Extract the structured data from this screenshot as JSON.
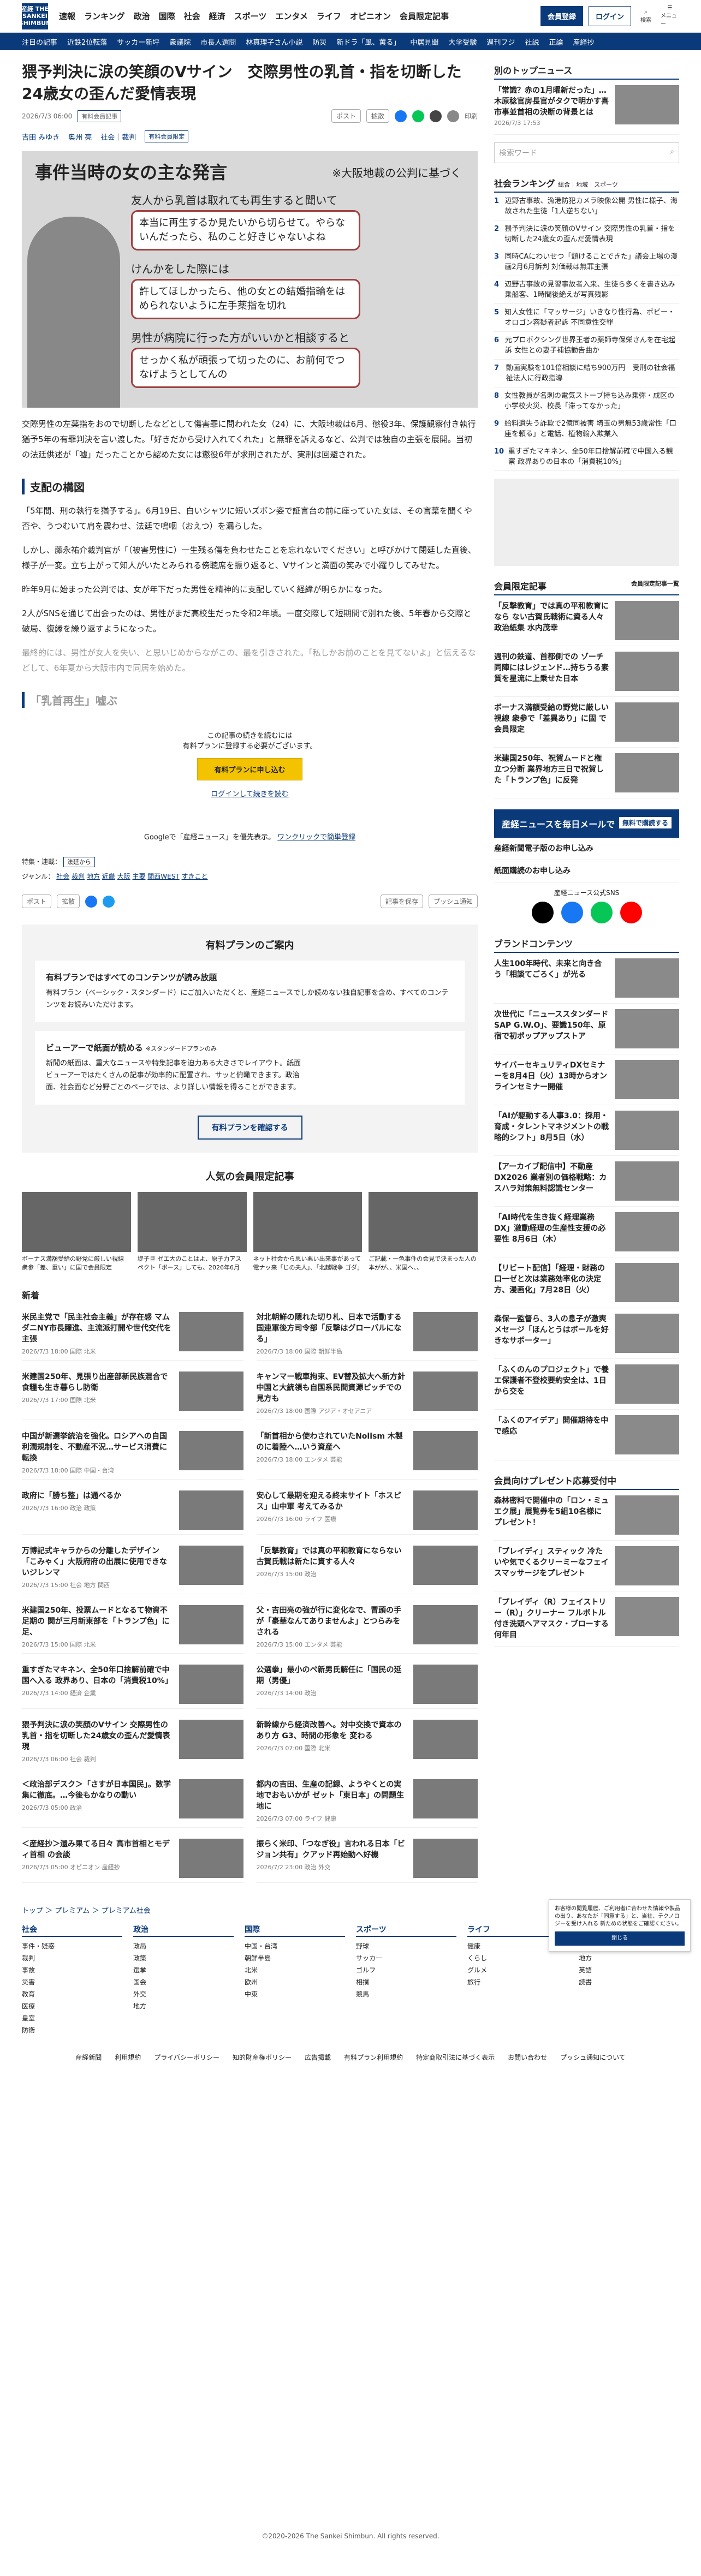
{
  "header": {
    "logo": "産経 THE SANKEI SHIMBUN",
    "nav": [
      "速報",
      "ランキング",
      "政治",
      "国際",
      "社会",
      "経済",
      "スポーツ",
      "エンタメ",
      "ライフ",
      "オピニオン",
      "会員限定記事"
    ],
    "member": "会員登録",
    "login": "ログイン",
    "search": "検索",
    "menu": "メニュー"
  },
  "subnav": [
    "注目の記事",
    "近鉄2位転落",
    "サッカー新坪",
    "衆議院",
    "市長人選問",
    "林真理子さん小説",
    "防災",
    "新ドラ「風、薫る」",
    "中居見聞",
    "大学受験",
    "週刊フジ",
    "社説",
    "正論",
    "産経抄"
  ],
  "article": {
    "title": "猥予判決に涙の笑顔のVサイン　交際男性の乳首・指を切断した24歳女の歪んだ愛情表現",
    "date": "2026/7/3 06:00",
    "paid": "有料会員記事",
    "post": "ポスト",
    "share": "拡散",
    "print": "印刷",
    "authors": [
      "吉田 みゆき",
      "奥州 亮"
    ],
    "category": "社会｜裁判",
    "limited": "有料会員限定",
    "hero_title": "事件当時の女の主な発言",
    "hero_note": "※大阪地裁の公判に基づく",
    "quotes": [
      "友人から乳首は取れても再生すると聞いて",
      "けんかをした際には",
      "男性が病院に行った方がいいかと相談すると"
    ],
    "bubbles": [
      "本当に再生するか見たいから切らせて。やらないんだったら、私のこと好きじゃないよね",
      "許してほしかったら、他の女との結婚指輪をはめられないように左手薬指を切れ",
      "せっかく私が頑張って切ったのに、お前何でつなげようとしてんの"
    ],
    "lead": "交際男性の左薬指をおので切断したなどとして傷害罪に問われた女（24）に、大阪地裁は6月、懲役3年、保護観察付き執行猶予5年の有罪判決を言い渡した。「好きだから受け入れてくれた」と無罪を訴えるなど、公判では独自の主張を展開。当初の法廷供述が「嘘」だったことから認めた女には懲役6年が求刑されたが、実刑は回避された。",
    "section": "支配の構図",
    "paras": [
      "「5年間、刑の執行を猶予する」。6月19日、白いシャツに短いズボン姿で証言台の前に座っていた女は、その言葉を聞くや否や、うつむいて肩を震わせ、法廷で鳴咽（おえつ）を漏らした。",
      "しかし、藤永祐介裁判官が「（被害男性に）一生残る傷を負わせたことを忘れないでください」と呼びかけて閉廷した直後、様子が一変。立ち上がって知人がいたとみられる傍聴席を振り返ると、Vサインと満面の笑みで小躍りしてみせた。",
      "昨年9月に始まった公判では、女が年下だった男性を精神的に支配していく経緯が明らかになった。",
      "2人がSNSを通じて出会ったのは、男性がまだ高校生だった令和2年頃。一度交際して短期間で別れた後、5年春から交際と破局、復縁を繰り返すようになった。",
      "最終的には、男性が女人を失い、と思いじめからながこの、最を引きされた。「私しかお前のことを見てないよ」と伝えるなどして、6年夏から大阪市内で同居を始めた。"
    ],
    "faded_head": "「乳首再生」嘘ぶ",
    "paywall_text": [
      "この記事の続きを読むには",
      "有料プランに登録する必要がございます。"
    ],
    "paywall_btn": "有料プランに申し込む",
    "login_link": "ログインして続きを読む",
    "google": "Googleで「産経ニュース」を優先表示。",
    "google_link": "ワンクリックで簡単登録",
    "feature_label": "特集・連載：",
    "feature": "法廷から",
    "genre_label": "ジャンル：",
    "genres": [
      "社会",
      "裁判",
      "地方",
      "近畿",
      "大阪",
      "主要",
      "関西WEST",
      "すきこと"
    ],
    "bookmark": "記事を保存",
    "push": "プッシュ通知"
  },
  "plan": {
    "title": "有料プランのご案内",
    "head": "有料プランではすべてのコンテンツが読み放題",
    "desc": "有料プラン（ベーシック・スタンダード）にご加入いただくと、産経ニュースでしか読めない独自記事を含め、すべてのコンテンツをお読みいただけます。",
    "viewer": "ビューアーで紙面が読める",
    "viewer_tag": "※スタンダードプランのみ",
    "viewer_desc": "新聞の紙面は、重大なニュースや特集記事を迫力ある大きさでレイアウト。紙面ビューアーではたくさんの記事が効率的に配置され、サッと俯瞰できます。政治面、社会面など分野ごとのページでは、より詳しい情報を得ることができます。",
    "btn": "有料プランを確認する"
  },
  "popular": {
    "title": "人気の会員限定記事",
    "items": [
      "ボーナス満額受給の野党に厳しい視線 衆参「差、重い」に国で会員限定",
      "堤子旦 ゼエ大のことはよ、原子力アスペクト「ボース」しても、2026年6月",
      "ネット社会から思い悪い出来事があって電ナッ来「じの夫人」、「北越戦争 ゴダ」",
      "ご記載・一色事件の会見で決まった人の本がが、、米国へ、、"
    ]
  },
  "news": {
    "title": "新着",
    "items": [
      {
        "t": "米民主党で「民主社会主義」が存在感 マムダニNY市長躍進、主流派打開や世代交代を主張",
        "d": "2026/7/3 18:00 国際 北米"
      },
      {
        "t": "対北朝鮮の隠れた切り札、日本で活動する国連軍後方司令部「反撃はグローバルになる」",
        "d": "2026/7/3 18:00 国際 朝鮮半島"
      },
      {
        "t": "米建国250年、見張り出産部新民族混合で食糧も生き暮らし防衛",
        "d": "2026/7/3 17:00 国際 北米"
      },
      {
        "t": "キャンマー戦車拘束、EV替及拡大へ新方針 中国と大統領も自国系民間資源ピッチでの見方も",
        "d": "2026/7/3 18:00 国際 アジア・オセアニア"
      },
      {
        "t": "中国が新選挙統治を強化。ロシアへの自国利潤規制を、不動産不況…サービス消費に転換",
        "d": "2026/7/3 18:00 国際 中国・台湾"
      },
      {
        "t": "「新首相から使わされていたNolism 木製のに着陸へ…いう資産へ",
        "d": "2026/7/3 18:00 エンタメ 芸能"
      },
      {
        "t": "政府に「勝ち整」は通べるか",
        "d": "2026/7/3 16:00 政治 政策"
      },
      {
        "t": "安心して最期を迎える終末サイト「ホスピス」山中軍 考えてみるか",
        "d": "2026/7/3 16:00 ライフ 医療"
      },
      {
        "t": "万博記式キャラからの分離したデザイン「こみゃく」大阪府府の出展に使用できないジレンマ",
        "d": "2026/7/3 15:00 社会 地方 関西"
      },
      {
        "t": "「反撃教育」では真の平和教育にならない 古賀氏戦は新たに資する人々",
        "d": "2026/7/3 15:00 政治"
      },
      {
        "t": "米建国250年、投票ムードとなるて物資不足期の 関が三月新東部を「トランプ色」に足、",
        "d": "2026/7/3 15:00 国際 北米"
      },
      {
        "t": "父・吉田亮の強が行に変化なで、冒頭の手が「豪華なんてありませんよ」とつらみをされる",
        "d": "2026/7/3 15:00 エンタメ 芸能"
      },
      {
        "t": "重すぎたマキネン、全50年口捨解前確で中国へ入る 政界あり、日本の「消費税10%」",
        "d": "2026/7/3 14:00 経済 企業"
      },
      {
        "t": "公選拳」最小のペ新男氏解任に「国民の延期（男優」",
        "d": "2026/7/3 14:00 政治"
      },
      {
        "t": "猥予判決に涙の笑顔のVサイン 交際男性の乳首・指を切断した24歳女の歪んだ愛情表現",
        "d": "2026/7/3 06:00 社会 裁判"
      },
      {
        "t": "新幹線から経済改善へ。対中交換で資本のあり方 G3、時間の形象を 変わる",
        "d": "2026/7/3 07:00 国際 北米"
      },
      {
        "t": "＜政治部デスク＞「さすが日本国民」。数学集に徹底。…今後もかなりの動い",
        "d": "2026/7/3 05:00 政治"
      },
      {
        "t": "都内の吉田、生産の記録、ようやくとの実地でおもいかが ゼット「東日本」の問題生地に",
        "d": "2026/7/3 07:00 ライフ 健康"
      },
      {
        "t": "＜産経抄＞還み果てる日々 高市首相とモディ首相 の会談",
        "d": "2026/7/3 05:00 オピニオン 産経抄"
      },
      {
        "t": "振らく米印、「つなぎ役」言われる日本「ビジョン共有」クアッド再始動へ好機",
        "d": "2026/7/2 23:00 政治 外交"
      }
    ]
  },
  "side": {
    "top_title": "別のトップニュース",
    "top_item": "「常識？赤の1月曜新だった」…木原稔官房長官がタクで明かす喜市事並首相の決断の背景とは",
    "top_date": "2026/7/3 17:53",
    "search_ph": "検索ワード",
    "rank_title": "社会ランキング",
    "tabs": [
      "総合",
      "地域",
      "スポーツ"
    ],
    "ranks": [
      "辺野古事故、漁港防犯カメラ映像公開 男性に様子、海故された生徒「1人逆ちない」",
      "猥予判決に涙の笑顔のVサイン 交際男性の乳首・指を切断した24歳女の歪んだ愛情表現",
      "同時CAにわいせつ「頭けることできた」議会上場の漫画2月6月訴判 対価裁は無罪主張",
      "辺野古事故の見習事故者入来、生徒ら多くを書き込み乗船客、1時間後絶えが写真残影",
      "知人女性に「マッサージ」いきなり性行為、ボビー・オロゴン容疑者起訴 不同意性交罪",
      "元プロボクシング世界王者の薬師寺保栄さんを在宅起訴 女性との妻子補協勧告曲か",
      "動画実験を101倍相談に結ち900万円　受刑の社会福祉法人に行政指導",
      "女性教員が名刺の電気ストーブ持ち込み乗弥・成区の小学校火災、校長「滞ってなかった」",
      "給料遺失う詐欺で2億同被害 埼玉の男無53歳常性「口座を頼る」と電話、植物輸入欺業入",
      "重すぎたマキネン、全50年口捨解前確で中国入る観察 政界ありの日本の「消費税10%」"
    ],
    "member_title": "会員限定記事",
    "member_link": "会員限定記事一覧",
    "member_items": [
      "「反撃教育」では真の平和教育になら ない古賀氏戦術に資る人々 政治紙集 水内茂幸",
      "週刊の鉄道、首都側での ゾーチ同陣にはレジェンド…持ちうる素質を星流に上乗せた日本",
      "ボーナス満額受給の野党に厳しい視線 衆参で「差異あり」に固 で会員限定",
      "米建国250年、祝賀ムードと権立つ分断 業界地方三日で祝賀した「トランプ色」に反発"
    ],
    "banner": "産経ニュースを毎日メールで",
    "banner_tag": "無料で購読する",
    "mail": "産経新聞電子版のお申し込み",
    "paper": "紙面購読のお申し込み",
    "sns": "産経ニュース公式SNS",
    "brand": "ブランドコンテンツ",
    "brands": [
      "人生100年時代、未来と向き合う「相談てごろく」が光る",
      "次世代に「ニューススタンダードSAP G.W.O」、要識150年、原宿で初ポップアップストア",
      "サイバーセキュリティDXセミナーを8月4日（火）13時からオンラインセミナー開催",
      "「AIが駆動する人事3.0：採用・育成・タレントマネジメントの戦略的シフト」8月5日（水）",
      "【アーカイブ配信中】不動産DX2026 業者別の価格戦略：カスハラ対策無料認識センター",
      "「AI時代を生き抜く経理業務DX」激動経理の生産性支援の必要性 8月6日（木）",
      "【リビート配信】「経理・財務の口一ゼと次は業務効率化の決定方、漫画化」7月28日（火）",
      "森保一監督ら、3人の息子が激爽メセージ「ほんとうはボールを好きなサポーター」",
      "「ふくのんのプロジェクト」で養エ保護者不登校要約安全は、1日から交を",
      "「ふくのアイデア」開催期待を中で感応"
    ],
    "event_title": "会員向けプレゼント応募受付中",
    "events": [
      "森林密料で開催中の「ロン・ミュエク展」展覧券を5組10名様にプレゼント！",
      "「プレイディ」スティック 冷たいや気でくるクリーミーなフェイスマッサージをプレゼント",
      "「プレイディ（R）フェイストリー（R）」クリーナー フルボトル付き洗頭ヘアマスク・ブローする 何年目"
    ]
  },
  "cookie": {
    "text": "お客様の閲覧履歴、ご利用者に合わせた情報や製品の出り、あなたが「同意する」と、当社、テクノロジーを受け入れる 新ための状態をご確認ください。",
    "btn": "閉じる"
  },
  "footer": {
    "crumbs": [
      "トップ",
      "プレミアム",
      "プレミアム社会"
    ],
    "cols": [
      {
        "h": "社会",
        "items": [
          "事件・疑惑",
          "裁判",
          "事故",
          "災害",
          "教育",
          "医療",
          "皇室",
          "防衛"
        ]
      },
      {
        "h": "政治",
        "items": [
          "政局",
          "政策",
          "選挙",
          "国会",
          "外交",
          "地方"
        ]
      },
      {
        "h": "国際",
        "items": [
          "中国・台湾",
          "朝鮮半島",
          "北米",
          "欧州",
          "中東"
        ]
      },
      {
        "h": "スポーツ",
        "items": [
          "野球",
          "サッカー",
          "ゴルフ",
          "相撲",
          "競馬"
        ]
      },
      {
        "h": "ライフ",
        "items": [
          "健康",
          "くらし",
          "グルメ",
          "旅行"
        ]
      },
      {
        "h": "その他",
        "items": [
          "写真・動画",
          "地方",
          "英語",
          "読書"
        ]
      }
    ],
    "links": [
      "産経新聞",
      "利用規約",
      "プライバシーポリシー",
      "知的財産権ポリシー",
      "広告掲載",
      "有料プラン利用規約",
      "特定商取引法に基づく表示",
      "お問い合わせ",
      "プッシュ通知について"
    ],
    "copyright": "©2020-2026 The Sankei Shimbun. All rights reserved."
  }
}
